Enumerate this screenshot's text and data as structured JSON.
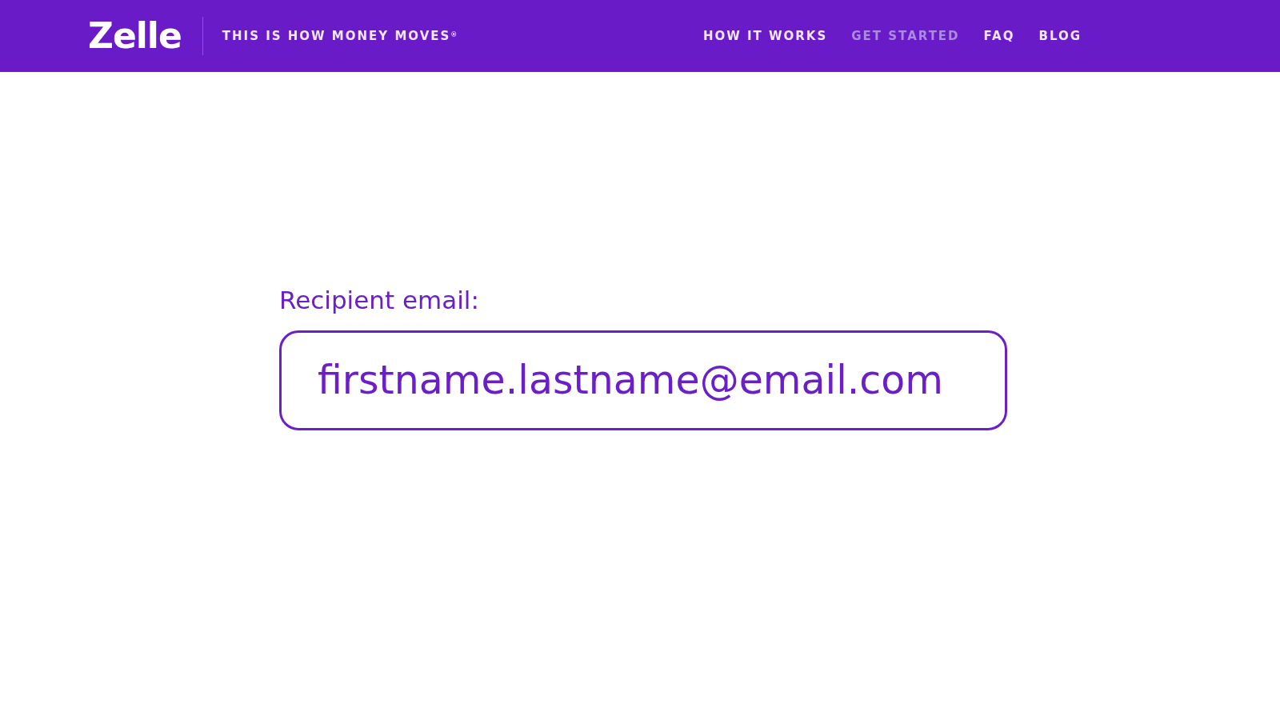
{
  "header": {
    "logo": "Zelle",
    "tagline": "THIS IS HOW MONEY MOVES$^{®}$",
    "nav": [
      {
        "label": "HOW IT WORKS",
        "selected": false
      },
      {
        "label": "GET STARTED",
        "selected": true
      },
      {
        "label": "FAQ",
        "selected": false
      },
      {
        "label": "BLOG",
        "selected": false
      }
    ]
  },
  "form": {
    "label": "Recipient email:",
    "value": "firstname.lastname@email.com"
  }
}
